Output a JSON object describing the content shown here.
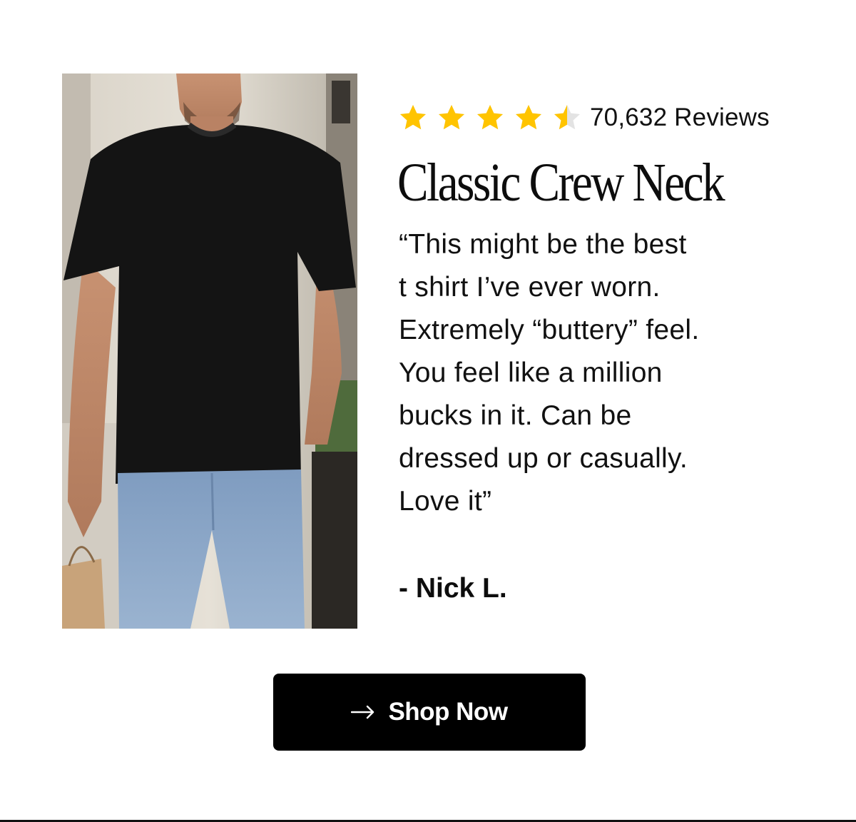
{
  "product_image": {
    "alt": "Man wearing a black crew neck t-shirt and light blue jeans"
  },
  "rating": {
    "stars_value": 4.5,
    "stars_max": 5,
    "star_color": "#FFC400",
    "star_empty_color": "#E3E3E3",
    "review_count_label": "70,632 Reviews"
  },
  "product": {
    "title": "Classic Crew Neck"
  },
  "review": {
    "quote_lines": [
      "“This might be the best",
      "t shirt I’ve ever worn.",
      "Extremely “buttery” feel.",
      "You feel like a million",
      "bucks in it. Can be",
      "dressed up or casually.",
      "Love it”"
    ],
    "reviewer": "- Nick L."
  },
  "cta": {
    "label": "Shop Now",
    "icon": "arrow-right-icon",
    "background": "#000000",
    "text_color": "#FFFFFF"
  }
}
